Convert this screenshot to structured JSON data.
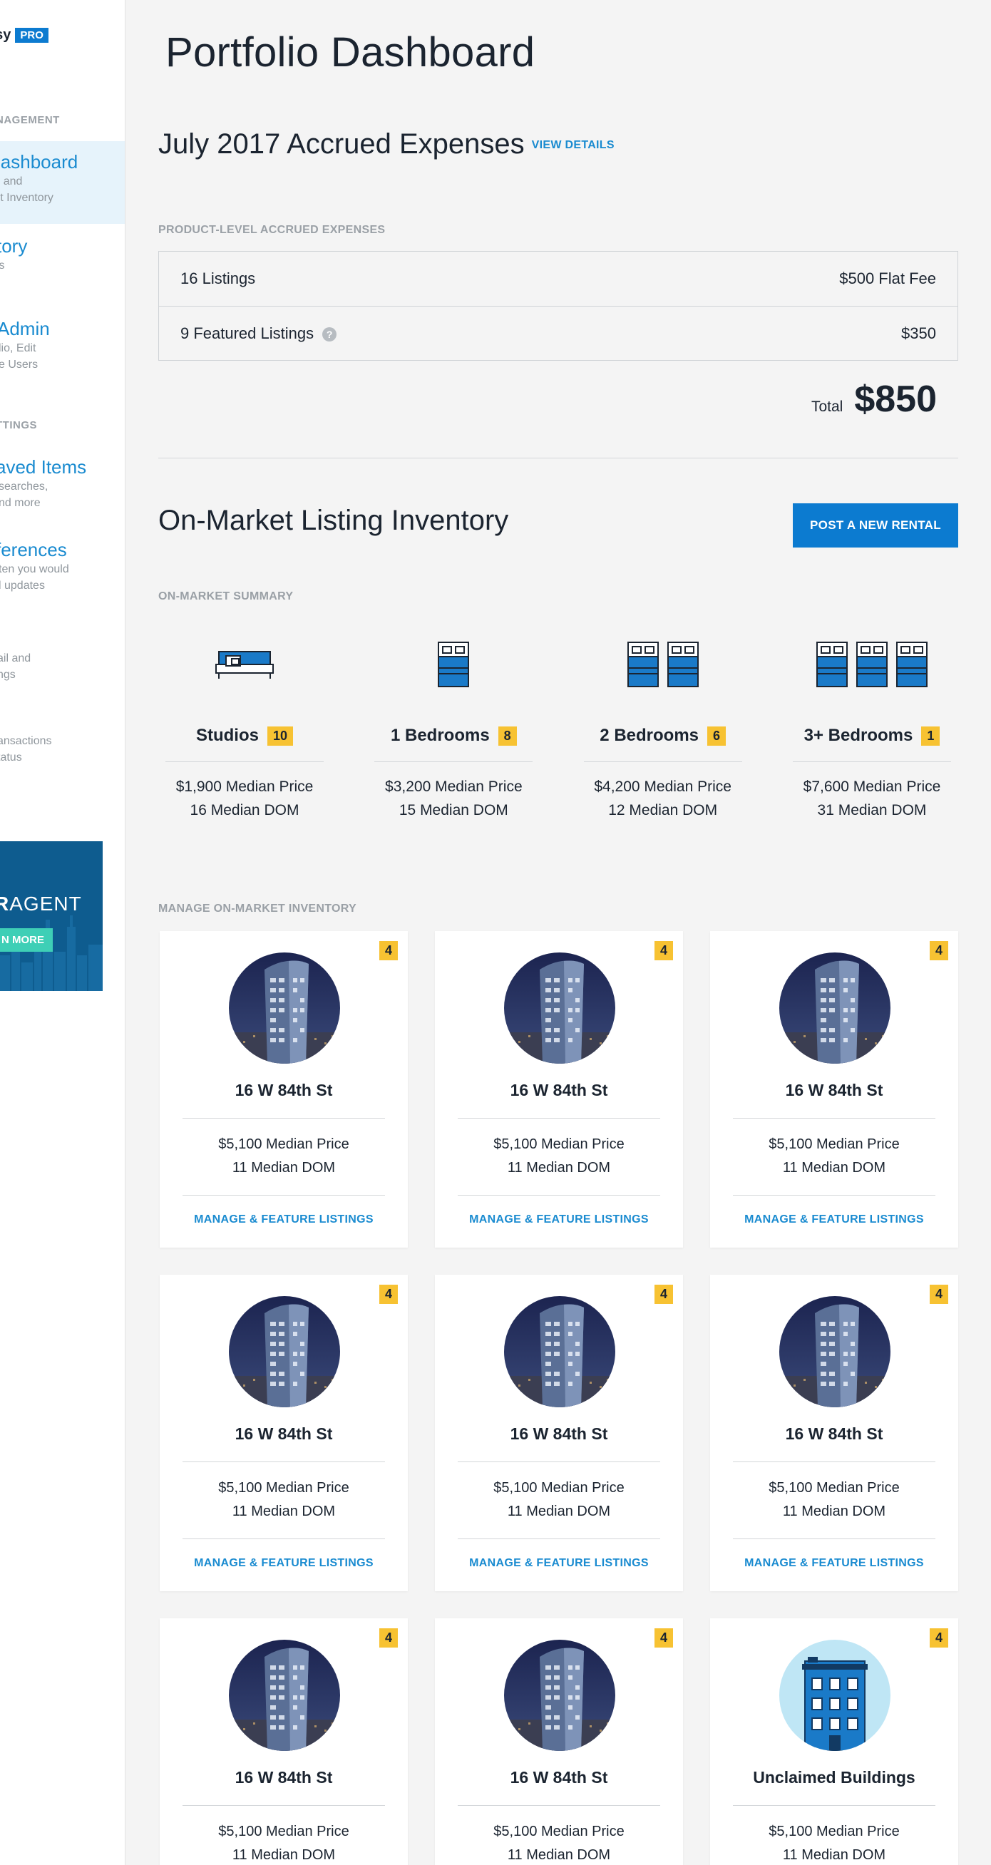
{
  "sidebar": {
    "brand_text": "asy",
    "brand_badge": "PRO",
    "section_management": "NAGEMENT",
    "items": [
      {
        "title": "Dashboard",
        "desc1": "ge, and",
        "desc2": "rket Inventory"
      },
      {
        "title": "story",
        "desc1": "ices",
        "desc2": ""
      },
      {
        "title": "Admin",
        "desc1": "lio, Edit",
        "desc2": "e Users"
      }
    ],
    "section_settings": "TTINGS",
    "settings_items": [
      {
        "title": "aved Items",
        "desc1": "searches,",
        "desc2": "nd more"
      },
      {
        "title": "ferences",
        "desc1": "ten you would",
        "desc2": "l updates"
      }
    ],
    "plain_items": [
      {
        "line1": "ail and",
        "line2": "ngs"
      },
      {
        "line1": "ansactions",
        "line2": "tatus"
      }
    ],
    "promo": {
      "title_bold": "R",
      "title_rest": "AGENT",
      "button": "N MORE"
    }
  },
  "main": {
    "page_title": "Portfolio Dashboard",
    "expenses": {
      "title": "July 2017 Accrued Expenses",
      "link": "VIEW DETAILS",
      "caption": "PRODUCT-LEVEL ACCRUED EXPENSES",
      "rows": [
        {
          "label": "16 Listings",
          "value": "$500 Flat Fee"
        },
        {
          "label": "9 Featured Listings",
          "value": "$350"
        }
      ],
      "help_icon": "?",
      "total_label": "Total",
      "total_value": "$850"
    },
    "inventory": {
      "title": "On-Market Listing Inventory",
      "post_button": "POST A NEW RENTAL",
      "summary_caption": "ON-MARKET SUMMARY",
      "summary": [
        {
          "label": "Studios",
          "count": "10",
          "price": "$1,900 Median Price",
          "dom": "16 Median DOM",
          "icon": "sofa-icon"
        },
        {
          "label": "1 Bedrooms",
          "count": "8",
          "price": "$3,200 Median Price",
          "dom": "15 Median DOM",
          "icon": "bed-icon"
        },
        {
          "label": "2 Bedrooms",
          "count": "6",
          "price": "$4,200 Median Price",
          "dom": "12 Median DOM",
          "icon": "two-beds-icon"
        },
        {
          "label": "3+ Bedrooms",
          "count": "1",
          "price": "$7,600 Median Price",
          "dom": "31 Median DOM",
          "icon": "three-beds-icon"
        }
      ],
      "manage_caption": "MANAGE ON-MARKET INVENTORY",
      "cards": [
        {
          "name": "16 W 84th St",
          "badge": "4",
          "price": "$5,100 Median Price",
          "dom": "11 Median DOM",
          "link": "MANAGE & FEATURE LISTINGS",
          "image": "building-photo"
        },
        {
          "name": "16 W 84th St",
          "badge": "4",
          "price": "$5,100 Median Price",
          "dom": "11 Median DOM",
          "link": "MANAGE & FEATURE LISTINGS",
          "image": "building-photo"
        },
        {
          "name": "16 W 84th St",
          "badge": "4",
          "price": "$5,100 Median Price",
          "dom": "11 Median DOM",
          "link": "MANAGE & FEATURE LISTINGS",
          "image": "building-photo"
        },
        {
          "name": "16 W 84th St",
          "badge": "4",
          "price": "$5,100 Median Price",
          "dom": "11 Median DOM",
          "link": "MANAGE & FEATURE LISTINGS",
          "image": "building-photo"
        },
        {
          "name": "16 W 84th St",
          "badge": "4",
          "price": "$5,100 Median Price",
          "dom": "11 Median DOM",
          "link": "MANAGE & FEATURE LISTINGS",
          "image": "building-photo"
        },
        {
          "name": "16 W 84th St",
          "badge": "4",
          "price": "$5,100 Median Price",
          "dom": "11 Median DOM",
          "link": "MANAGE & FEATURE LISTINGS",
          "image": "building-photo"
        },
        {
          "name": "16 W 84th St",
          "badge": "4",
          "price": "$5,100 Median Price",
          "dom": "11 Median DOM",
          "link": "MANAGE & FEATURE LISTINGS",
          "image": "building-photo"
        },
        {
          "name": "16 W 84th St",
          "badge": "4",
          "price": "$5,100 Median Price",
          "dom": "11 Median DOM",
          "link": "MANAGE & FEATURE LISTINGS",
          "image": "building-photo"
        },
        {
          "name": "Unclaimed Buildings",
          "badge": "4",
          "price": "$5,100 Median Price",
          "dom": "11 Median DOM",
          "link": "MANAGE & FEATURE LISTINGS",
          "image": "building-illustration-icon"
        }
      ]
    }
  },
  "colors": {
    "accent": "#0c7bd0",
    "link": "#1a8bd0",
    "badge": "#f7c232",
    "page_bg": "#f4f4f4"
  }
}
